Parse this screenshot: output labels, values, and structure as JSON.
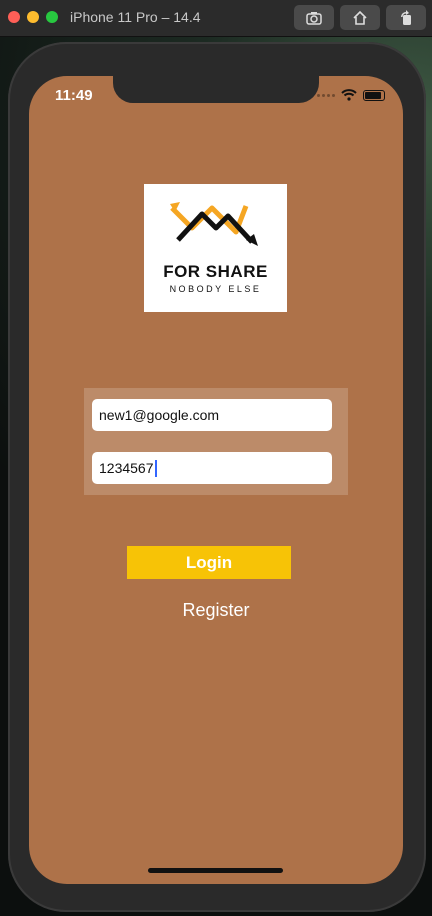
{
  "window": {
    "title": "iPhone 11 Pro – 14.4"
  },
  "status_bar": {
    "time": "11:49"
  },
  "logo": {
    "title": "FOR SHARE",
    "subtitle": "NOBODY ELSE"
  },
  "form": {
    "email_value": "new1@google.com",
    "password_value": "1234567"
  },
  "actions": {
    "login_label": "Login",
    "register_label": "Register"
  },
  "colors": {
    "background": "#ae7249",
    "login_button": "#f7c306"
  }
}
